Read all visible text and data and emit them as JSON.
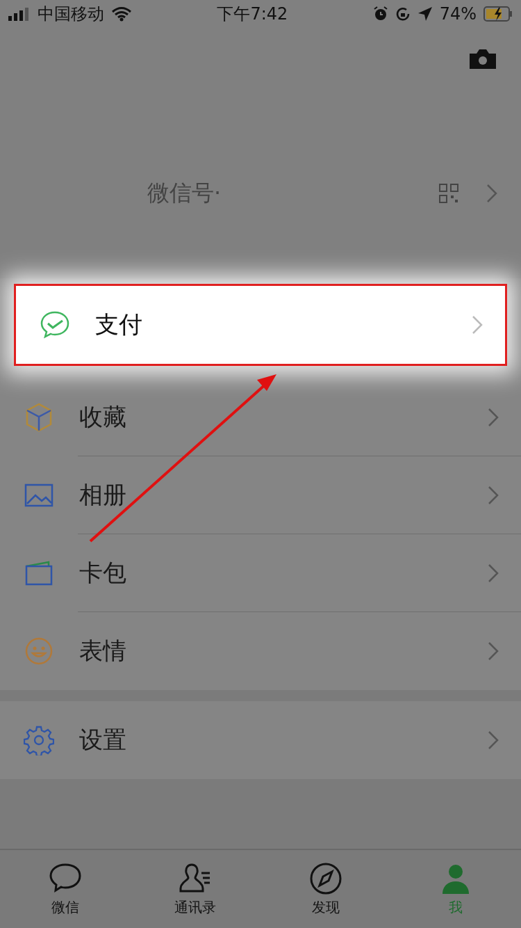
{
  "status_bar": {
    "carrier": "中国移动",
    "time": "下午7:42",
    "battery": "74%",
    "charging": true
  },
  "profile": {
    "wechat_id_label": "微信号·"
  },
  "menu_groups": [
    {
      "items": [
        {
          "label": "支付",
          "kind": "pay",
          "highlighted": true
        }
      ]
    },
    {
      "items": [
        {
          "label": "收藏",
          "kind": "favorites",
          "highlighted": false
        },
        {
          "label": "相册",
          "kind": "album",
          "highlighted": false
        },
        {
          "label": "卡包",
          "kind": "cards",
          "highlighted": false
        },
        {
          "label": "表情",
          "kind": "stickers",
          "highlighted": false
        }
      ]
    },
    {
      "items": [
        {
          "label": "设置",
          "kind": "settings",
          "highlighted": false
        }
      ]
    }
  ],
  "tab_bar": [
    {
      "label": "微信",
      "kind": "chat",
      "selected": false
    },
    {
      "label": "通讯录",
      "kind": "contacts",
      "selected": false
    },
    {
      "label": "发现",
      "kind": "discover",
      "selected": false
    },
    {
      "label": "我",
      "kind": "me",
      "selected": true
    }
  ]
}
